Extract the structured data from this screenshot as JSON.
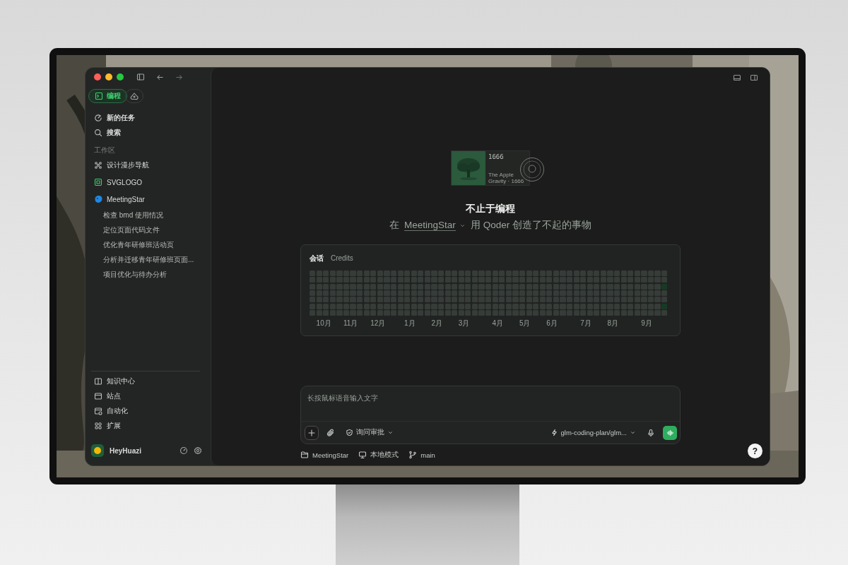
{
  "sidebar": {
    "mode_tabs": [
      {
        "kind": "text",
        "label": "编程",
        "selected": true
      },
      {
        "kind": "icon",
        "selected": false
      }
    ],
    "actions": [
      {
        "kind": "new-task",
        "label": "新的任务"
      },
      {
        "kind": "search",
        "label": "搜索"
      }
    ],
    "section_title": "工作区",
    "workspaces": [
      {
        "kind": "flower",
        "label": "设计漫步导航"
      },
      {
        "kind": "square",
        "label": "SVGLOGO"
      },
      {
        "kind": "blob",
        "label": "MeetingStar",
        "children": [
          {
            "label": "检查 bmd 使用情况"
          },
          {
            "label": "定位页面代码文件"
          },
          {
            "label": "优化青年研修班活动页"
          },
          {
            "label": "分析并迁移青年研修班页面..."
          },
          {
            "label": "项目优化与待办分析"
          }
        ]
      }
    ],
    "bottom_items": [
      {
        "kind": "book",
        "label": "知识中心"
      },
      {
        "kind": "site",
        "label": "站点"
      },
      {
        "kind": "automation",
        "label": "自动化"
      },
      {
        "kind": "extensions",
        "label": "扩展"
      }
    ],
    "user": {
      "name": "HeyHuazi"
    }
  },
  "main": {
    "hero_card": {
      "title": "1666",
      "line_1": "The Apple",
      "line_2": "Gravity · 1666"
    },
    "headline": "不止于编程",
    "subtitle": {
      "prefix": "在",
      "project": "MeetingStar",
      "suffix": "用 Qoder 创造了不起的事物"
    },
    "activity": {
      "tabs": [
        {
          "label": "会话",
          "selected": true
        },
        {
          "label": "Credits",
          "selected": false
        }
      ],
      "rows": [
        {
          "cells": [
            {
              "active": false
            },
            {
              "active": false
            },
            {
              "active": false
            },
            {
              "active": false
            },
            {
              "active": false
            },
            {
              "active": false
            },
            {
              "active": false
            },
            {
              "active": false
            },
            {
              "active": false
            },
            {
              "active": false
            },
            {
              "active": false
            },
            {
              "active": false
            },
            {
              "active": false
            },
            {
              "active": false
            },
            {
              "active": false
            },
            {
              "active": false
            },
            {
              "active": false
            },
            {
              "active": false
            },
            {
              "active": false
            },
            {
              "active": false
            },
            {
              "active": false
            },
            {
              "active": false
            },
            {
              "active": false
            },
            {
              "active": false
            },
            {
              "active": false
            },
            {
              "active": false
            },
            {
              "active": false
            },
            {
              "active": false
            },
            {
              "active": false
            },
            {
              "active": false
            },
            {
              "active": false
            },
            {
              "active": false
            },
            {
              "active": false
            },
            {
              "active": false
            },
            {
              "active": false
            },
            {
              "active": false
            },
            {
              "active": false
            },
            {
              "active": false
            },
            {
              "active": false
            },
            {
              "active": false
            },
            {
              "active": false
            },
            {
              "active": false
            },
            {
              "active": false
            },
            {
              "active": false
            },
            {
              "active": false
            },
            {
              "active": false
            },
            {
              "active": false
            },
            {
              "active": false
            },
            {
              "active": false
            },
            {
              "active": false
            },
            {
              "active": false
            },
            {
              "active": false
            },
            {
              "active": false
            }
          ]
        },
        {
          "cells": [
            {
              "active": false
            },
            {
              "active": false
            },
            {
              "active": false
            },
            {
              "active": false
            },
            {
              "active": false
            },
            {
              "active": false
            },
            {
              "active": false
            },
            {
              "active": false
            },
            {
              "active": false
            },
            {
              "active": false
            },
            {
              "active": false
            },
            {
              "active": false
            },
            {
              "active": false
            },
            {
              "active": false
            },
            {
              "active": false
            },
            {
              "active": false
            },
            {
              "active": false
            },
            {
              "active": false
            },
            {
              "active": false
            },
            {
              "active": false
            },
            {
              "active": false
            },
            {
              "active": false
            },
            {
              "active": false
            },
            {
              "active": false
            },
            {
              "active": false
            },
            {
              "active": false
            },
            {
              "active": false
            },
            {
              "active": false
            },
            {
              "active": false
            },
            {
              "active": false
            },
            {
              "active": false
            },
            {
              "active": false
            },
            {
              "active": false
            },
            {
              "active": false
            },
            {
              "active": false
            },
            {
              "active": false
            },
            {
              "active": false
            },
            {
              "active": false
            },
            {
              "active": false
            },
            {
              "active": false
            },
            {
              "active": false
            },
            {
              "active": false
            },
            {
              "active": false
            },
            {
              "active": false
            },
            {
              "active": false
            },
            {
              "active": false
            },
            {
              "active": false
            },
            {
              "active": false
            },
            {
              "active": false
            },
            {
              "active": false
            },
            {
              "active": false
            },
            {
              "active": false
            },
            {
              "active": false
            }
          ]
        },
        {
          "cells": [
            {
              "active": false
            },
            {
              "active": false
            },
            {
              "active": false
            },
            {
              "active": false
            },
            {
              "active": false
            },
            {
              "active": false
            },
            {
              "active": false
            },
            {
              "active": false
            },
            {
              "active": false
            },
            {
              "active": false
            },
            {
              "active": false
            },
            {
              "active": false
            },
            {
              "active": false
            },
            {
              "active": false
            },
            {
              "active": false
            },
            {
              "active": false
            },
            {
              "active": false
            },
            {
              "active": false
            },
            {
              "active": false
            },
            {
              "active": false
            },
            {
              "active": false
            },
            {
              "active": false
            },
            {
              "active": false
            },
            {
              "active": false
            },
            {
              "active": false
            },
            {
              "active": false
            },
            {
              "active": false
            },
            {
              "active": false
            },
            {
              "active": false
            },
            {
              "active": false
            },
            {
              "active": false
            },
            {
              "active": false
            },
            {
              "active": false
            },
            {
              "active": false
            },
            {
              "active": false
            },
            {
              "active": false
            },
            {
              "active": false
            },
            {
              "active": false
            },
            {
              "active": false
            },
            {
              "active": false
            },
            {
              "active": false
            },
            {
              "active": false
            },
            {
              "active": false
            },
            {
              "active": false
            },
            {
              "active": false
            },
            {
              "active": false
            },
            {
              "active": false
            },
            {
              "active": false
            },
            {
              "active": false
            },
            {
              "active": false
            },
            {
              "active": false
            },
            {
              "active": false
            },
            {
              "active": true
            }
          ]
        },
        {
          "cells": [
            {
              "active": false
            },
            {
              "active": false
            },
            {
              "active": false
            },
            {
              "active": false
            },
            {
              "active": false
            },
            {
              "active": false
            },
            {
              "active": false
            },
            {
              "active": false
            },
            {
              "active": false
            },
            {
              "active": false
            },
            {
              "active": false
            },
            {
              "active": false
            },
            {
              "active": false
            },
            {
              "active": false
            },
            {
              "active": false
            },
            {
              "active": false
            },
            {
              "active": false
            },
            {
              "active": false
            },
            {
              "active": false
            },
            {
              "active": false
            },
            {
              "active": false
            },
            {
              "active": false
            },
            {
              "active": false
            },
            {
              "active": false
            },
            {
              "active": false
            },
            {
              "active": false
            },
            {
              "active": false
            },
            {
              "active": false
            },
            {
              "active": false
            },
            {
              "active": false
            },
            {
              "active": false
            },
            {
              "active": false
            },
            {
              "active": false
            },
            {
              "active": false
            },
            {
              "active": false
            },
            {
              "active": false
            },
            {
              "active": false
            },
            {
              "active": false
            },
            {
              "active": false
            },
            {
              "active": false
            },
            {
              "active": false
            },
            {
              "active": false
            },
            {
              "active": false
            },
            {
              "active": false
            },
            {
              "active": false
            },
            {
              "active": false
            },
            {
              "active": false
            },
            {
              "active": false
            },
            {
              "active": false
            },
            {
              "active": false
            },
            {
              "active": false
            },
            {
              "active": false
            },
            {
              "active": false
            }
          ]
        },
        {
          "cells": [
            {
              "active": false
            },
            {
              "active": false
            },
            {
              "active": false
            },
            {
              "active": false
            },
            {
              "active": false
            },
            {
              "active": false
            },
            {
              "active": false
            },
            {
              "active": false
            },
            {
              "active": false
            },
            {
              "active": false
            },
            {
              "active": false
            },
            {
              "active": false
            },
            {
              "active": false
            },
            {
              "active": false
            },
            {
              "active": false
            },
            {
              "active": false
            },
            {
              "active": false
            },
            {
              "active": false
            },
            {
              "active": false
            },
            {
              "active": false
            },
            {
              "active": false
            },
            {
              "active": false
            },
            {
              "active": false
            },
            {
              "active": false
            },
            {
              "active": false
            },
            {
              "active": false
            },
            {
              "active": false
            },
            {
              "active": false
            },
            {
              "active": false
            },
            {
              "active": false
            },
            {
              "active": false
            },
            {
              "active": false
            },
            {
              "active": false
            },
            {
              "active": false
            },
            {
              "active": false
            },
            {
              "active": false
            },
            {
              "active": false
            },
            {
              "active": false
            },
            {
              "active": false
            },
            {
              "active": false
            },
            {
              "active": false
            },
            {
              "active": false
            },
            {
              "active": false
            },
            {
              "active": false
            },
            {
              "active": false
            },
            {
              "active": false
            },
            {
              "active": false
            },
            {
              "active": false
            },
            {
              "active": false
            },
            {
              "active": false
            },
            {
              "active": false
            },
            {
              "active": false
            },
            {
              "active": false
            }
          ]
        },
        {
          "cells": [
            {
              "active": false
            },
            {
              "active": false
            },
            {
              "active": false
            },
            {
              "active": false
            },
            {
              "active": false
            },
            {
              "active": false
            },
            {
              "active": false
            },
            {
              "active": false
            },
            {
              "active": false
            },
            {
              "active": false
            },
            {
              "active": false
            },
            {
              "active": false
            },
            {
              "active": false
            },
            {
              "active": false
            },
            {
              "active": false
            },
            {
              "active": false
            },
            {
              "active": false
            },
            {
              "active": false
            },
            {
              "active": false
            },
            {
              "active": false
            },
            {
              "active": false
            },
            {
              "active": false
            },
            {
              "active": false
            },
            {
              "active": false
            },
            {
              "active": false
            },
            {
              "active": false
            },
            {
              "active": false
            },
            {
              "active": false
            },
            {
              "active": false
            },
            {
              "active": false
            },
            {
              "active": false
            },
            {
              "active": false
            },
            {
              "active": false
            },
            {
              "active": false
            },
            {
              "active": false
            },
            {
              "active": false
            },
            {
              "active": false
            },
            {
              "active": false
            },
            {
              "active": false
            },
            {
              "active": false
            },
            {
              "active": false
            },
            {
              "active": false
            },
            {
              "active": false
            },
            {
              "active": false
            },
            {
              "active": false
            },
            {
              "active": false
            },
            {
              "active": false
            },
            {
              "active": false
            },
            {
              "active": false
            },
            {
              "active": false
            },
            {
              "active": false
            },
            {
              "active": false
            },
            {
              "active": true
            }
          ]
        },
        {
          "cells": [
            {
              "active": false
            },
            {
              "active": false
            },
            {
              "active": false
            },
            {
              "active": false
            },
            {
              "active": false
            },
            {
              "active": false
            },
            {
              "active": false
            },
            {
              "active": false
            },
            {
              "active": false
            },
            {
              "active": false
            },
            {
              "active": false
            },
            {
              "active": false
            },
            {
              "active": false
            },
            {
              "active": false
            },
            {
              "active": false
            },
            {
              "active": false
            },
            {
              "active": false
            },
            {
              "active": false
            },
            {
              "active": false
            },
            {
              "active": false
            },
            {
              "active": false
            },
            {
              "active": false
            },
            {
              "active": false
            },
            {
              "active": false
            },
            {
              "active": false
            },
            {
              "active": false
            },
            {
              "active": false
            },
            {
              "active": false
            },
            {
              "active": false
            },
            {
              "active": false
            },
            {
              "active": false
            },
            {
              "active": false
            },
            {
              "active": false
            },
            {
              "active": false
            },
            {
              "active": false
            },
            {
              "active": false
            },
            {
              "active": false
            },
            {
              "active": false
            },
            {
              "active": false
            },
            {
              "active": false
            },
            {
              "active": false
            },
            {
              "active": false
            },
            {
              "active": false
            },
            {
              "active": false
            },
            {
              "active": false
            },
            {
              "active": false
            },
            {
              "active": false
            },
            {
              "active": false
            },
            {
              "active": false
            },
            {
              "active": false
            },
            {
              "active": false
            },
            {
              "active": false
            },
            {
              "active": false
            }
          ]
        }
      ],
      "months": [
        {
          "label": "10月"
        },
        {
          "label": "11月"
        },
        {
          "label": "12月"
        },
        {
          "label": "1月"
        },
        {
          "label": "2月"
        },
        {
          "label": "3月"
        },
        {
          "label": "4月"
        },
        {
          "label": "5月"
        },
        {
          "label": "6月"
        },
        {
          "label": "7月"
        },
        {
          "label": "8月"
        },
        {
          "label": "9月"
        }
      ]
    },
    "composer": {
      "placeholder": "长按鼠标语音输入文字",
      "approval": "询问审批",
      "model": "glm-coding-plan/glm..."
    },
    "footer": [
      {
        "kind": "folder",
        "label": "MeetingStar"
      },
      {
        "kind": "monitor",
        "label": "本地模式"
      },
      {
        "kind": "branch",
        "label": "main"
      }
    ],
    "help": "?"
  }
}
